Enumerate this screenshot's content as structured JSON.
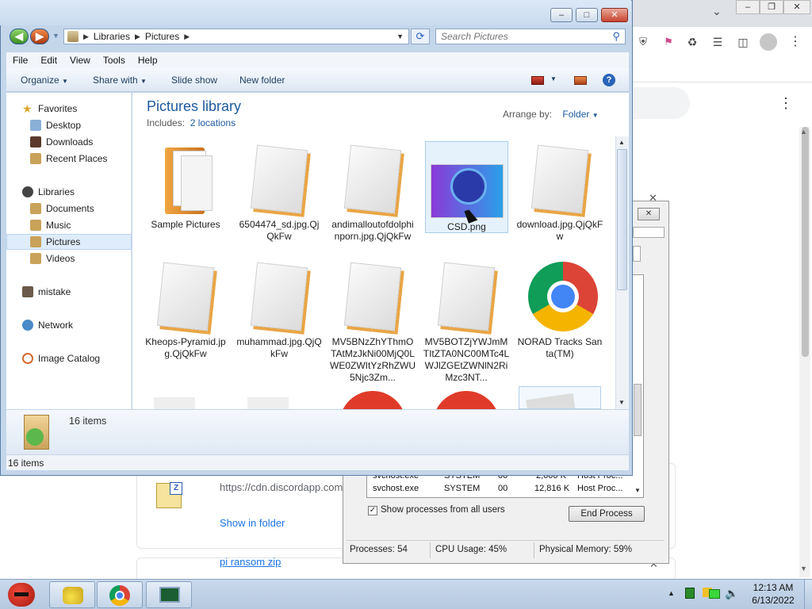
{
  "explorer": {
    "breadcrumb": [
      "Libraries",
      "Pictures"
    ],
    "search_placeholder": "Search Pictures",
    "menu": [
      "File",
      "Edit",
      "View",
      "Tools",
      "Help"
    ],
    "commands": [
      "Organize",
      "Share with",
      "Slide show",
      "New folder"
    ],
    "nav": {
      "favorites": "Favorites",
      "favorites_items": [
        "Desktop",
        "Downloads",
        "Recent Places"
      ],
      "libraries": "Libraries",
      "libraries_items": [
        "Documents",
        "Music",
        "Pictures",
        "Videos"
      ],
      "selected": "Pictures",
      "others": [
        "mistake",
        "Network",
        "Image Catalog"
      ]
    },
    "library_title": "Pictures library",
    "includes_label": "Includes:",
    "includes_link": "2 locations",
    "arrange_label": "Arrange by:",
    "arrange_value": "Folder",
    "files": [
      {
        "name": "Sample Pictures",
        "kind": "folder"
      },
      {
        "name": "6504474_sd.jpg.QjQkFw",
        "kind": "file"
      },
      {
        "name": "andimalloutofdolphinporn.jpg.QjQkFw",
        "kind": "file"
      },
      {
        "name": "CSD.png",
        "kind": "image"
      },
      {
        "name": "download.jpg.QjQkFw",
        "kind": "file"
      },
      {
        "name": "Kheops-Pyramid.jpg.QjQkFw",
        "kind": "file"
      },
      {
        "name": "muhammad.jpg.QjQkFw",
        "kind": "file"
      },
      {
        "name": "MV5BNzZhYThmOTAtMzJkNi00MjQ0LWE0ZWItYzRhZWU5Njc3Zm...",
        "kind": "file"
      },
      {
        "name": "MV5BOTZjYWJmMTItZTA0NC00MTc4LWJlZGEtZWNlN2RiMzc3NT...",
        "kind": "file"
      },
      {
        "name": "NORAD Tracks Santa(TM)",
        "kind": "chrome"
      }
    ],
    "details_count": "16 items",
    "status_count": "16 items"
  },
  "task_manager": {
    "processes": [
      {
        "name": "svchost.exe",
        "user": "SYSTEM",
        "cpu": "00",
        "mem": "2,600 K",
        "desc": "Host Proc..."
      },
      {
        "name": "svchost.exe",
        "user": "SYSTEM",
        "cpu": "00",
        "mem": "12,816 K",
        "desc": "Host Proc..."
      }
    ],
    "show_all_label": "Show processes from all users",
    "end_process": "End Process",
    "status": {
      "processes": "Processes: 54",
      "cpu": "CPU Usage: 45%",
      "memory": "Physical Memory: 59%"
    }
  },
  "chrome": {
    "download_url": "https://cdn.discordapp.com",
    "show_in_folder": "Show in folder",
    "next_download": "pi ransom zip"
  },
  "taskbar": {
    "time": "12:13 AM",
    "date": "6/13/2022"
  }
}
